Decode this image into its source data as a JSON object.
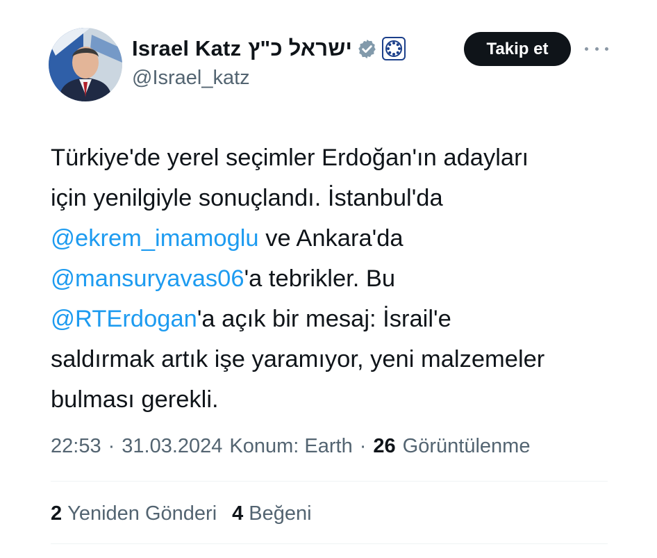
{
  "author": {
    "display_name": "Israel Katz",
    "hebrew_name": "ישראל כ\"ץ",
    "handle": "@Israel_katz",
    "verified_color": "#829aab"
  },
  "actions": {
    "follow_label": "Takip et"
  },
  "tweet": {
    "lines": [
      [
        {
          "text": "Türkiye'de yerel seçimler Erdoğan'ın adayları",
          "mention": false
        }
      ],
      [
        {
          "text": "için yenilgiyle sonuçlandı. İstanbul'da",
          "mention": false
        }
      ],
      [
        {
          "text": "@ekrem_imamoglu",
          "mention": true
        },
        {
          "text": " ve Ankara'da",
          "mention": false
        }
      ],
      [
        {
          "text": "@mansuryavas06",
          "mention": true
        },
        {
          "text": "'a tebrikler. Bu",
          "mention": false
        }
      ],
      [
        {
          "text": "@RTErdogan",
          "mention": true
        },
        {
          "text": "'a açık bir mesaj: İsrail'e",
          "mention": false
        }
      ],
      [
        {
          "text": "saldırmak artık işe yaramıyor, yeni malzemeler",
          "mention": false
        }
      ],
      [
        {
          "text": "bulması gerekli.",
          "mention": false
        }
      ]
    ]
  },
  "meta": {
    "time": "22:53",
    "separator": "·",
    "date": "31.03.2024",
    "location": "Konum: Earth",
    "views_count": "26",
    "views_label": "Görüntülenme"
  },
  "stats": {
    "reposts_count": "2",
    "reposts_label": "Yeniden Gönderi",
    "likes_count": "4",
    "likes_label": "Beğeni"
  },
  "colors": {
    "mention": "#1d9bf0",
    "secondary_text": "#536471",
    "button_bg": "#0f1419"
  }
}
